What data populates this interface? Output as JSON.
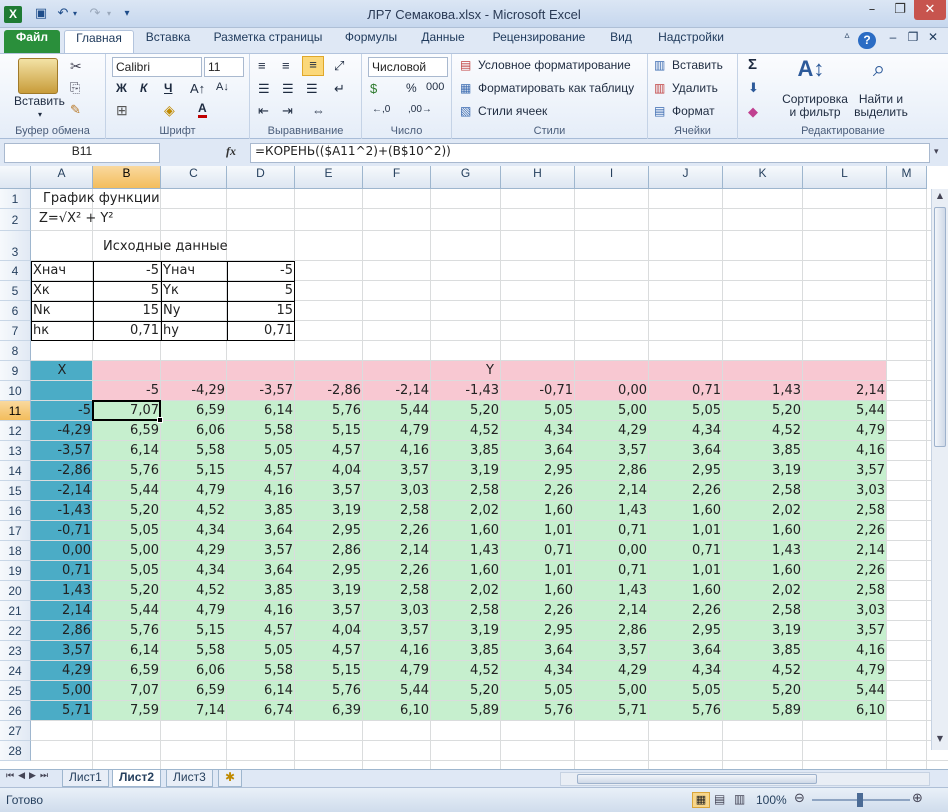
{
  "window": {
    "title": "ЛР7 Семакова.xlsx - Microsoft Excel",
    "app_icon": "X"
  },
  "ribbon_tabs": [
    "Файл",
    "Главная",
    "Вставка",
    "Разметка страницы",
    "Формулы",
    "Данные",
    "Рецензирование",
    "Вид",
    "Надстройки"
  ],
  "ribbon": {
    "clipboard": {
      "paste": "Вставить",
      "label": "Буфер обмена"
    },
    "font": {
      "name": "Calibri",
      "size": "11",
      "bold": "Ж",
      "italic": "К",
      "underline": "Ч",
      "label": "Шрифт"
    },
    "alignment": {
      "label": "Выравнивание"
    },
    "number": {
      "format": "Числовой",
      "percent": "%",
      "thousands": "000",
      "label": "Число"
    },
    "styles": {
      "conditional": "Условное форматирование",
      "as_table": "Форматировать как таблицу",
      "cell_styles": "Стили ячеек",
      "label": "Стили"
    },
    "cells": {
      "insert": "Вставить",
      "delete": "Удалить",
      "format": "Формат",
      "label": "Ячейки"
    },
    "editing": {
      "sum": "Σ",
      "sort_line1": "Сортировка",
      "sort_line2": "и фильтр",
      "find_line1": "Найти и",
      "find_line2": "выделить",
      "label": "Редактирование"
    }
  },
  "formula_bar": {
    "name_box": "B11",
    "fx": "fx",
    "formula": "=КОРЕНЬ(($A11^2)+(B$10^2))"
  },
  "columns": [
    "A",
    "B",
    "C",
    "D",
    "E",
    "F",
    "G",
    "H",
    "I",
    "J",
    "K",
    "L",
    "M"
  ],
  "rows": [
    "1",
    "2",
    "3",
    "4",
    "5",
    "6",
    "7",
    "8",
    "9",
    "10",
    "11",
    "12",
    "13",
    "14",
    "15",
    "16",
    "17",
    "18",
    "19",
    "20",
    "21",
    "22",
    "23",
    "24",
    "25",
    "26",
    "27",
    "28"
  ],
  "active_cell": "B11",
  "colors": {
    "x_header_bg": "#4bacc6",
    "y_header_bg": "#f8c8d2",
    "body_bg": "#c6efce",
    "selected_header": "#f5c86f"
  },
  "cells": {
    "title": "График функции",
    "formula_label": "Z=√X² + Y²",
    "section": "Исходные данные",
    "params": [
      {
        "l1": "Xнач",
        "v1": "-5",
        "l2": "Yнач",
        "v2": "-5"
      },
      {
        "l1": "Xк",
        "v1": "5",
        "l2": "Yк",
        "v2": "5"
      },
      {
        "l1": "Nк",
        "v1": "15",
        "l2": "Ny",
        "v2": "15"
      },
      {
        "l1": "hк",
        "v1": "0,71",
        "l2": "hy",
        "v2": "0,71"
      }
    ],
    "x_header": "X",
    "y_header": "Y",
    "y_values": [
      "-5",
      "-4,29",
      "-3,57",
      "-2,86",
      "-2,14",
      "-1,43",
      "-0,71",
      "0,00",
      "0,71",
      "1,43",
      "2,14"
    ],
    "x_values": [
      "-5",
      "-4,29",
      "-3,57",
      "-2,86",
      "-2,14",
      "-1,43",
      "-0,71",
      "0,00",
      "0,71",
      "1,43",
      "2,14",
      "2,86",
      "3,57",
      "4,29",
      "5,00",
      "5,71"
    ],
    "table": [
      [
        "7,07",
        "6,59",
        "6,14",
        "5,76",
        "5,44",
        "5,20",
        "5,05",
        "5,00",
        "5,05",
        "5,20",
        "5,44"
      ],
      [
        "6,59",
        "6,06",
        "5,58",
        "5,15",
        "4,79",
        "4,52",
        "4,34",
        "4,29",
        "4,34",
        "4,52",
        "4,79"
      ],
      [
        "6,14",
        "5,58",
        "5,05",
        "4,57",
        "4,16",
        "3,85",
        "3,64",
        "3,57",
        "3,64",
        "3,85",
        "4,16"
      ],
      [
        "5,76",
        "5,15",
        "4,57",
        "4,04",
        "3,57",
        "3,19",
        "2,95",
        "2,86",
        "2,95",
        "3,19",
        "3,57"
      ],
      [
        "5,44",
        "4,79",
        "4,16",
        "3,57",
        "3,03",
        "2,58",
        "2,26",
        "2,14",
        "2,26",
        "2,58",
        "3,03"
      ],
      [
        "5,20",
        "4,52",
        "3,85",
        "3,19",
        "2,58",
        "2,02",
        "1,60",
        "1,43",
        "1,60",
        "2,02",
        "2,58"
      ],
      [
        "5,05",
        "4,34",
        "3,64",
        "2,95",
        "2,26",
        "1,60",
        "1,01",
        "0,71",
        "1,01",
        "1,60",
        "2,26"
      ],
      [
        "5,00",
        "4,29",
        "3,57",
        "2,86",
        "2,14",
        "1,43",
        "0,71",
        "0,00",
        "0,71",
        "1,43",
        "2,14"
      ],
      [
        "5,05",
        "4,34",
        "3,64",
        "2,95",
        "2,26",
        "1,60",
        "1,01",
        "0,71",
        "1,01",
        "1,60",
        "2,26"
      ],
      [
        "5,20",
        "4,52",
        "3,85",
        "3,19",
        "2,58",
        "2,02",
        "1,60",
        "1,43",
        "1,60",
        "2,02",
        "2,58"
      ],
      [
        "5,44",
        "4,79",
        "4,16",
        "3,57",
        "3,03",
        "2,58",
        "2,26",
        "2,14",
        "2,26",
        "2,58",
        "3,03"
      ],
      [
        "5,76",
        "5,15",
        "4,57",
        "4,04",
        "3,57",
        "3,19",
        "2,95",
        "2,86",
        "2,95",
        "3,19",
        "3,57"
      ],
      [
        "6,14",
        "5,58",
        "5,05",
        "4,57",
        "4,16",
        "3,85",
        "3,64",
        "3,57",
        "3,64",
        "3,85",
        "4,16"
      ],
      [
        "6,59",
        "6,06",
        "5,58",
        "5,15",
        "4,79",
        "4,52",
        "4,34",
        "4,29",
        "4,34",
        "4,52",
        "4,79"
      ],
      [
        "7,07",
        "6,59",
        "6,14",
        "5,76",
        "5,44",
        "5,20",
        "5,05",
        "5,00",
        "5,05",
        "5,20",
        "5,44"
      ],
      [
        "7,59",
        "7,14",
        "6,74",
        "6,39",
        "6,10",
        "5,89",
        "5,76",
        "5,71",
        "5,76",
        "5,89",
        "6,10"
      ]
    ]
  },
  "sheet_tabs": [
    "Лист1",
    "Лист2",
    "Лист3"
  ],
  "active_sheet": "Лист2",
  "status": {
    "ready": "Готово",
    "zoom": "100%"
  }
}
